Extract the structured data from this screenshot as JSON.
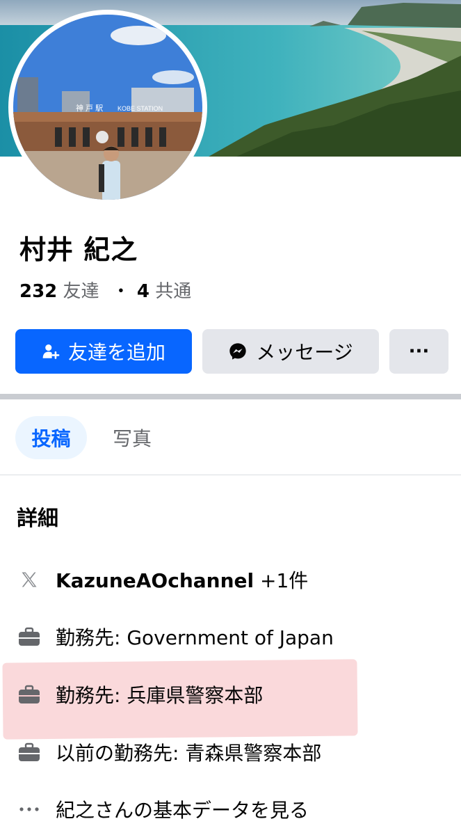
{
  "profile": {
    "name": "村井 紀之",
    "friends_count": "232",
    "friends_label": "友達",
    "separator": "・",
    "mutual_count": "4",
    "mutual_label": "共通"
  },
  "actions": {
    "add_friend": "友達を追加",
    "message": "メッセージ",
    "more": "···"
  },
  "tabs": [
    {
      "label": "投稿",
      "active": true
    },
    {
      "label": "写真",
      "active": false
    }
  ],
  "details": {
    "title": "詳細",
    "items": [
      {
        "icon": "x-logo-icon",
        "strong": "KazuneAOchannel",
        "text": " +1件"
      },
      {
        "icon": "briefcase-icon",
        "text": "勤務先: Government of Japan"
      },
      {
        "icon": "briefcase-icon",
        "text": "勤務先: 兵庫県警察本部"
      },
      {
        "icon": "briefcase-icon",
        "text": "以前の勤務先: 青森県警察本部"
      },
      {
        "icon": "ellipsis-icon",
        "text": "紀之さんの基本データを見る"
      }
    ]
  },
  "avatar_sign": {
    "top": "神 戸 駅",
    "sub": "KOBE STATION"
  },
  "colors": {
    "primary": "#0866ff",
    "secondary_button": "#e4e6eb",
    "muted_text": "#65676b",
    "highlight": "#f3aaaf"
  }
}
